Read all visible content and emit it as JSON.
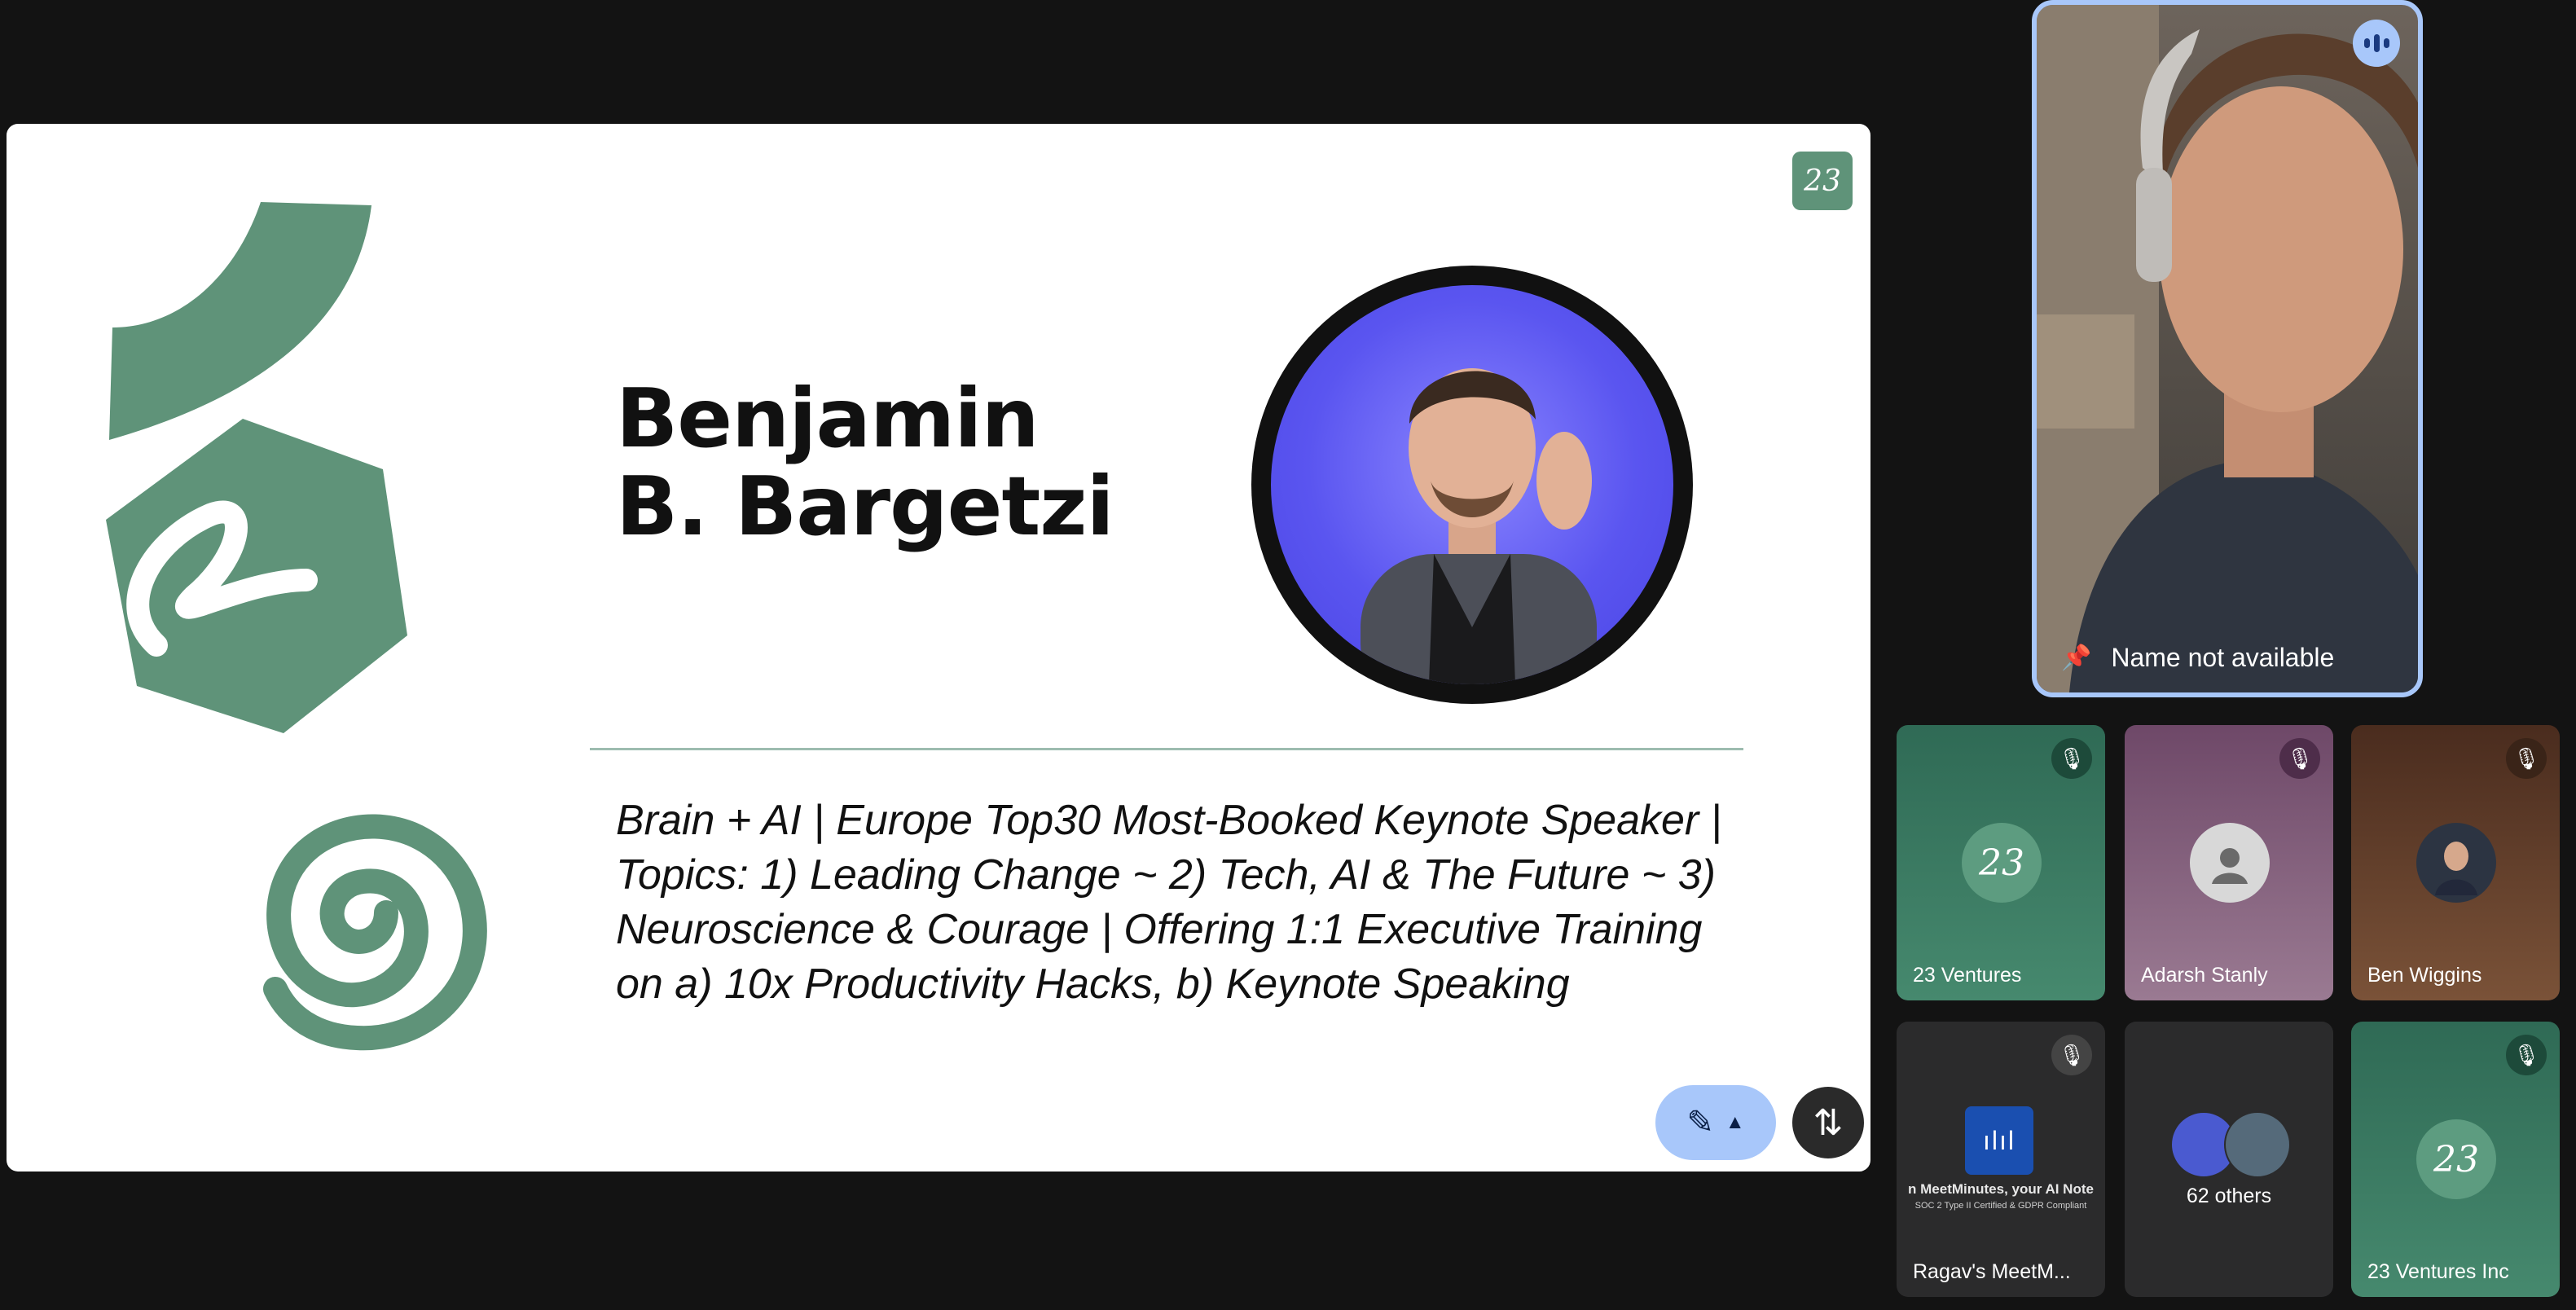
{
  "slide": {
    "logo": "23",
    "name_line1": "Benjamin",
    "name_line2": "B. Bargetzi",
    "bio_lines": [
      "Brain + AI | Europe Top30 Most-Booked Keynote Speaker |",
      "Topics: 1) Leading Change ~ 2) Tech, AI & The Future ~ 3)",
      "Neuroscience & Courage | Offering 1:1 Executive Training",
      "on a) 10x Productivity Hacks, b) Keynote Speaking"
    ],
    "accent_color": "#5f9379"
  },
  "controls": {
    "annotate_icon": "pen-icon",
    "expand_icon": "chevron-up-icon",
    "swap_icon": "swap-arrows-icon"
  },
  "active_speaker": {
    "name": "Name not available",
    "pin_icon": "pin-icon",
    "ring_color": "#a8c7fa"
  },
  "participants": [
    {
      "name": "23 Ventures",
      "avatar_text": "23",
      "muted": true
    },
    {
      "name": "Adarsh Stanly",
      "muted": true
    },
    {
      "name": "Ben Wiggins",
      "muted": true
    },
    {
      "name": "Ragav's MeetM...",
      "muted": true,
      "preview_caption": "n MeetMinutes, your AI Note",
      "preview_subcaption": "SOC 2 Type II Certified & GDPR Compliant"
    },
    {
      "name": "62 others",
      "muted": false
    },
    {
      "name": "23 Ventures Inc",
      "avatar_text": "23",
      "muted": true
    }
  ]
}
